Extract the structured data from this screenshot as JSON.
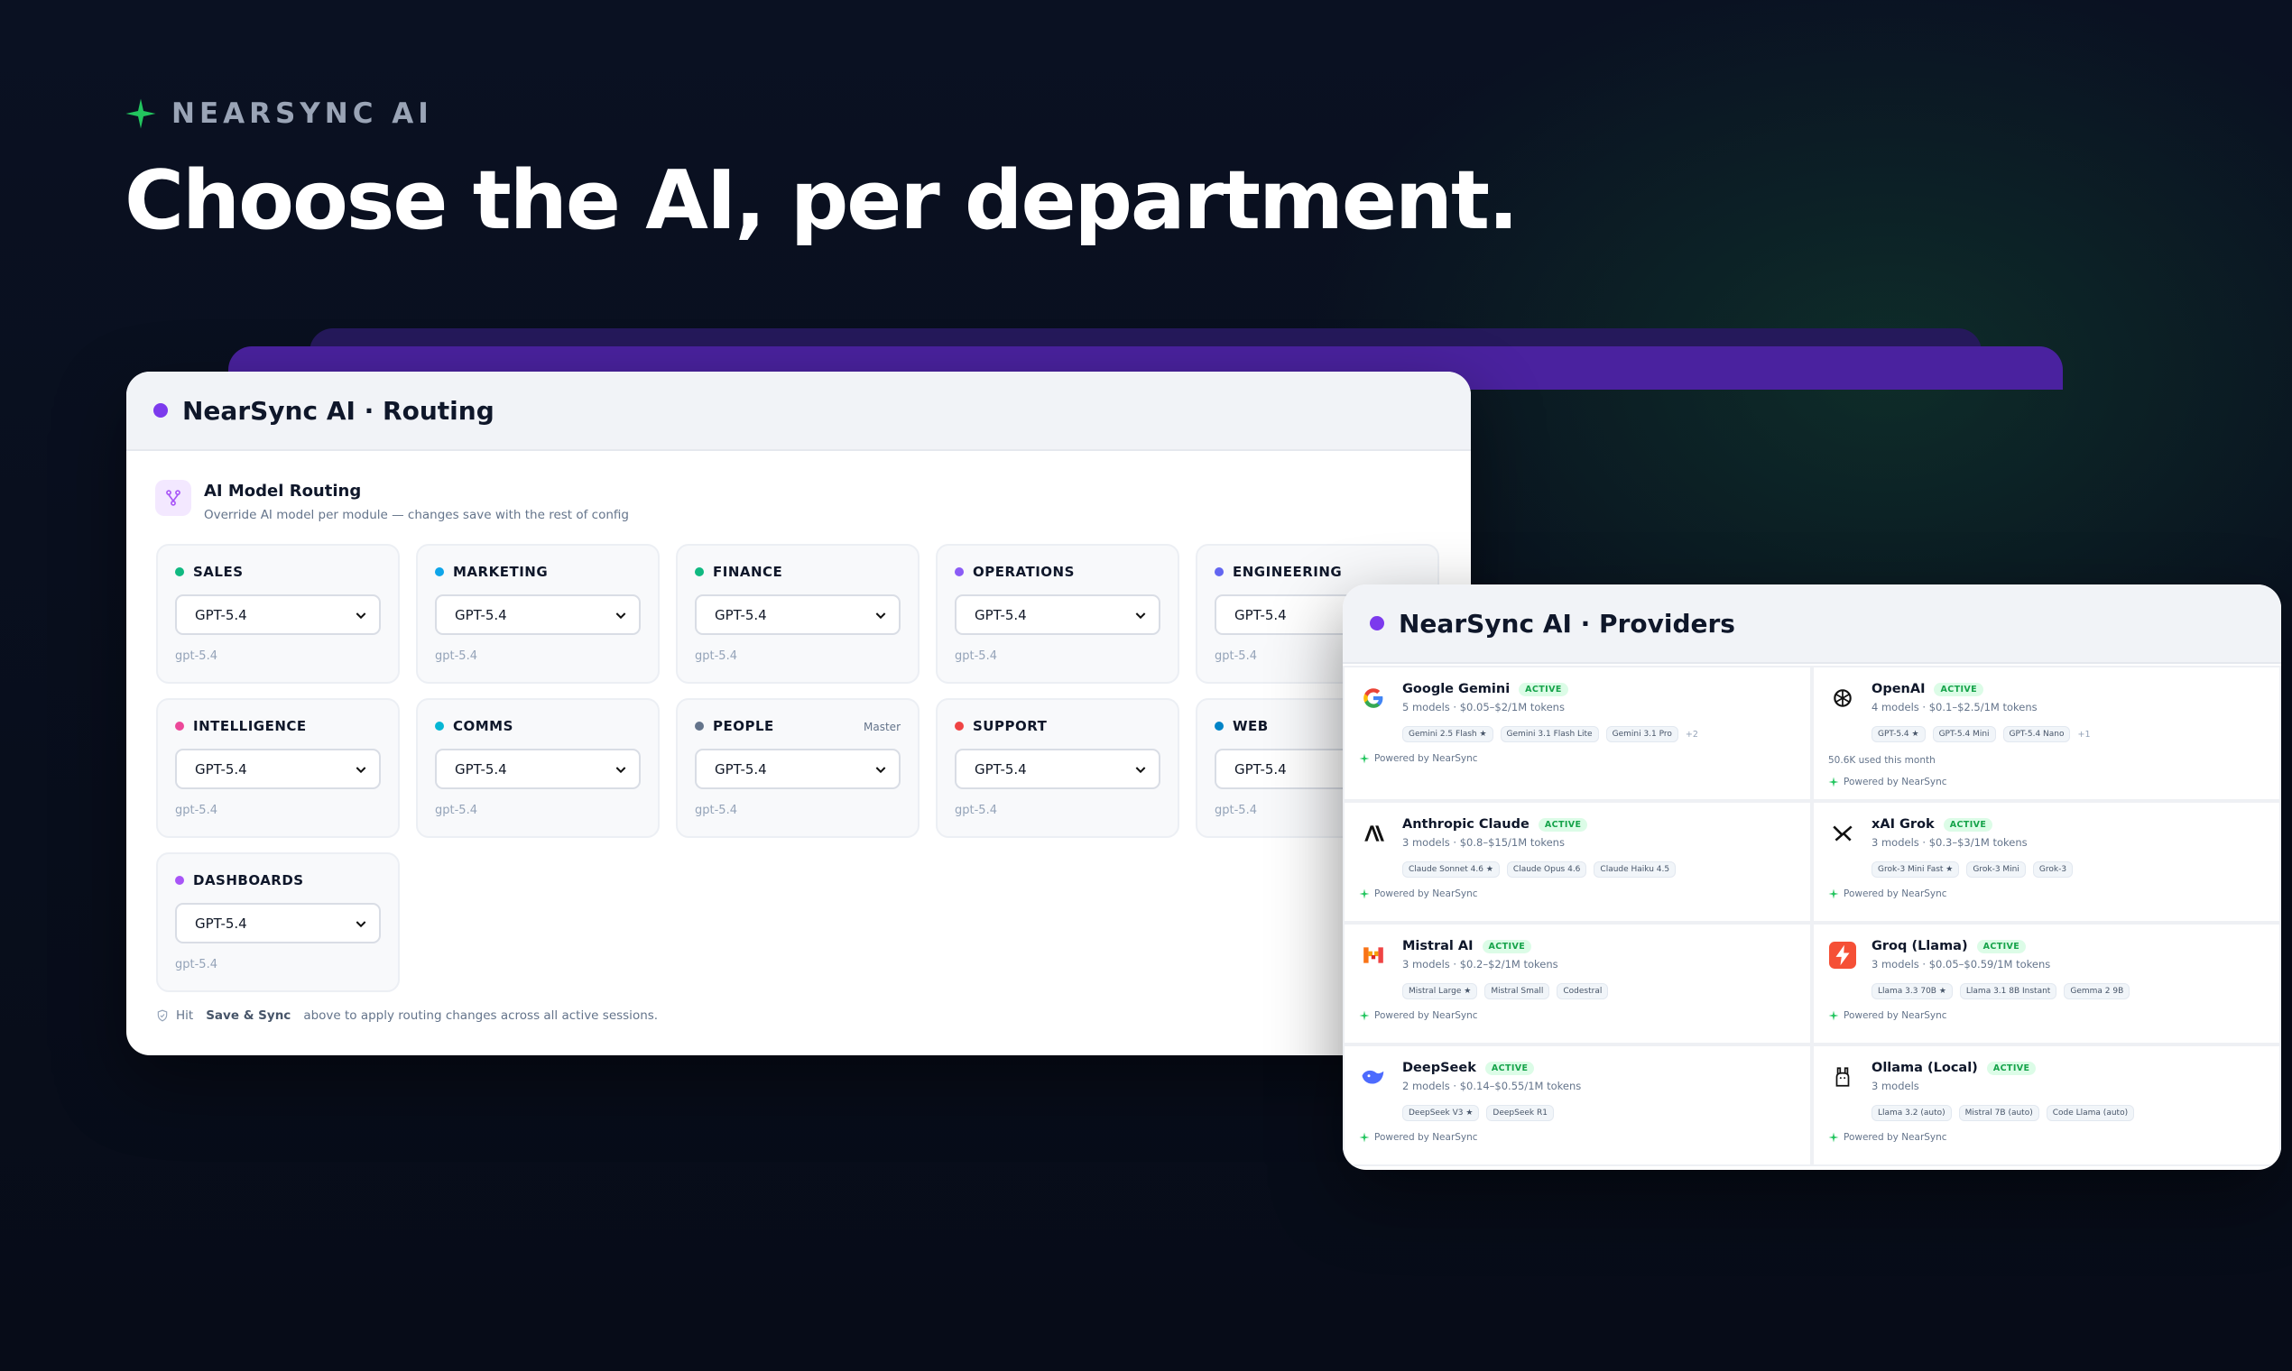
{
  "brand": {
    "name": "NEARSYNC AI",
    "accent": "#22c55e"
  },
  "headline": "Choose the AI, per department.",
  "routing": {
    "window_title": "NearSync AI · Routing",
    "section_title": "AI Model Routing",
    "section_subtitle": "Override AI model per module — changes save with the rest of config",
    "departments": [
      {
        "name": "SALES",
        "color": "#10b981",
        "model": "GPT-5.4",
        "model_id": "gpt-5.4",
        "tag": ""
      },
      {
        "name": "MARKETING",
        "color": "#0ea5e9",
        "model": "GPT-5.4",
        "model_id": "gpt-5.4",
        "tag": ""
      },
      {
        "name": "FINANCE",
        "color": "#10b981",
        "model": "GPT-5.4",
        "model_id": "gpt-5.4",
        "tag": ""
      },
      {
        "name": "OPERATIONS",
        "color": "#8b5cf6",
        "model": "GPT-5.4",
        "model_id": "gpt-5.4",
        "tag": ""
      },
      {
        "name": "ENGINEERING",
        "color": "#6366f1",
        "model": "GPT-5.4",
        "model_id": "gpt-5.4",
        "tag": ""
      },
      {
        "name": "INTELLIGENCE",
        "color": "#ec4899",
        "model": "GPT-5.4",
        "model_id": "gpt-5.4",
        "tag": ""
      },
      {
        "name": "COMMS",
        "color": "#06b6d4",
        "model": "GPT-5.4",
        "model_id": "gpt-5.4",
        "tag": ""
      },
      {
        "name": "PEOPLE",
        "color": "#64748b",
        "model": "GPT-5.4",
        "model_id": "gpt-5.4",
        "tag": "Master"
      },
      {
        "name": "SUPPORT",
        "color": "#ef4444",
        "model": "GPT-5.4",
        "model_id": "gpt-5.4",
        "tag": ""
      },
      {
        "name": "WEB",
        "color": "#0284c7",
        "model": "GPT-5.4",
        "model_id": "gpt-5.4",
        "tag": ""
      },
      {
        "name": "DASHBOARDS",
        "color": "#a855f7",
        "model": "GPT-5.4",
        "model_id": "gpt-5.4",
        "tag": ""
      }
    ],
    "hint": {
      "pre": "Hit",
      "bold": "Save & Sync",
      "post": "above to apply routing changes across all active sessions."
    }
  },
  "providers": {
    "window_title": "NearSync AI · Providers",
    "badge": "ACTIVE",
    "powered": "Powered by NearSync",
    "items": [
      {
        "name": "Google Gemini",
        "icon": "google-g-icon",
        "meta": "5 models · $0.05–$2/1M tokens",
        "chips": [
          "Gemini 2.5 Flash ★",
          "Gemini 3.1 Flash Lite",
          "Gemini 3.1 Pro"
        ],
        "more": "+2",
        "usage": ""
      },
      {
        "name": "OpenAI",
        "icon": "openai-icon",
        "meta": "4 models · $0.1–$2.5/1M tokens",
        "chips": [
          "GPT-5.4 ★",
          "GPT-5.4 Mini",
          "GPT-5.4 Nano"
        ],
        "more": "+1",
        "usage": "50.6K used this month"
      },
      {
        "name": "Anthropic Claude",
        "icon": "anthropic-icon",
        "meta": "3 models · $0.8–$15/1M tokens",
        "chips": [
          "Claude Sonnet 4.6 ★",
          "Claude Opus 4.6",
          "Claude Haiku 4.5"
        ],
        "more": "",
        "usage": ""
      },
      {
        "name": "xAI Grok",
        "icon": "xai-icon",
        "meta": "3 models · $0.3–$3/1M tokens",
        "chips": [
          "Grok-3 Mini Fast ★",
          "Grok-3 Mini",
          "Grok-3"
        ],
        "more": "",
        "usage": ""
      },
      {
        "name": "Mistral AI",
        "icon": "mistral-icon",
        "meta": "3 models · $0.2–$2/1M tokens",
        "chips": [
          "Mistral Large ★",
          "Mistral Small",
          "Codestral"
        ],
        "more": "",
        "usage": ""
      },
      {
        "name": "Groq (Llama)",
        "icon": "groq-bolt-icon",
        "meta": "3 models · $0.05–$0.59/1M tokens",
        "chips": [
          "Llama 3.3 70B ★",
          "Llama 3.1 8B Instant",
          "Gemma 2 9B"
        ],
        "more": "",
        "usage": ""
      },
      {
        "name": "DeepSeek",
        "icon": "deepseek-whale-icon",
        "meta": "2 models · $0.14–$0.55/1M tokens",
        "chips": [
          "DeepSeek V3 ★",
          "DeepSeek R1"
        ],
        "more": "",
        "usage": ""
      },
      {
        "name": "Ollama (Local)",
        "icon": "ollama-llama-icon",
        "meta": "3 models",
        "chips": [
          "Llama 3.2 (auto)",
          "Mistral 7B (auto)",
          "Code Llama (auto)"
        ],
        "more": "",
        "usage": ""
      }
    ]
  }
}
